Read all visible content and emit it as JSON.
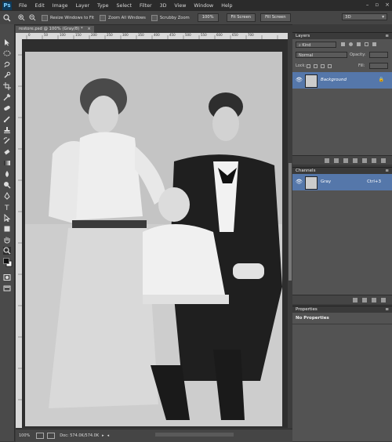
{
  "app": {
    "logo": "Ps"
  },
  "menu": [
    "File",
    "Edit",
    "Image",
    "Layer",
    "Type",
    "Select",
    "Filter",
    "3D",
    "View",
    "Window",
    "Help"
  ],
  "options": {
    "resize_label": "Resize Windows to Fit",
    "zoom_all_label": "Zoom All Windows",
    "scrubby_label": "Scrubby Zoom",
    "btn_100": "100%",
    "btn_fit": "Fit Screen",
    "btn_fill": "Fill Screen",
    "workspace": "3D"
  },
  "document": {
    "tab_title": "restore.psd @ 100% (Gray/8) *",
    "ruler_ticks": [
      "0",
      "50",
      "100",
      "150",
      "200",
      "250",
      "300",
      "350",
      "400",
      "450",
      "500",
      "550",
      "600",
      "650",
      "700"
    ],
    "zoom": "100%",
    "doc_size": "Doc: 574.0K/574.0K"
  },
  "layers": {
    "title": "Layers",
    "kind": "Kind",
    "blend_mode": "Normal",
    "opacity_label": "Opacity:",
    "lock_label": "Lock:",
    "fill_label": "Fill:",
    "layer_name": "Background"
  },
  "channels": {
    "title": "Channels",
    "channel_name": "Gray",
    "shortcut": "Ctrl+3"
  },
  "properties": {
    "title": "Properties",
    "empty_text": "No Properties"
  },
  "colors": {
    "accent": "#5577aa",
    "panel": "#535353",
    "chrome": "#454545"
  }
}
